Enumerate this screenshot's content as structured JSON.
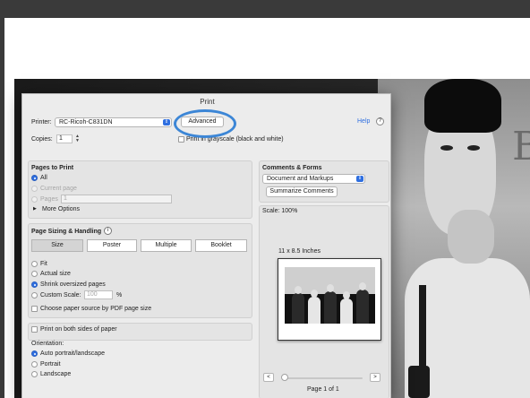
{
  "dialog": {
    "title": "Print",
    "printer_label": "Printer:",
    "printer_value": "RC-Ricoh-C831DN",
    "advanced_label": "Advanced",
    "help_label": "Help",
    "help_icon": "?",
    "copies_label": "Copies:",
    "copies_value": "1",
    "grayscale_label": "Print in grayscale (black and white)"
  },
  "pages_to_print": {
    "heading": "Pages to Print",
    "all_label": "All",
    "current_label": "Current page",
    "pages_label": "Pages",
    "pages_value": "1",
    "more_options_label": "More Options"
  },
  "sizing": {
    "heading": "Page Sizing & Handling",
    "info_icon": "i",
    "tabs": [
      "Size",
      "Poster",
      "Multiple",
      "Booklet"
    ],
    "selected_tab": "Size",
    "fit_label": "Fit",
    "actual_label": "Actual size",
    "shrink_label": "Shrink oversized pages",
    "custom_label": "Custom Scale:",
    "custom_value": "100",
    "percent_label": "%",
    "paper_source_label": "Choose paper source by PDF page size"
  },
  "duplex": {
    "both_sides_label": "Print on both sides of paper"
  },
  "orientation": {
    "heading": "Orientation:",
    "auto_label": "Auto portrait/landscape",
    "portrait_label": "Portrait",
    "landscape_label": "Landscape"
  },
  "comments": {
    "heading": "Comments & Forms",
    "select_value": "Document and Markups",
    "summarize_label": "Summarize Comments"
  },
  "preview": {
    "scale_label": "Scale: 100%",
    "paper_size_label": "11 x 8.5 Inches",
    "prev_label": "<",
    "next_label": ">",
    "page_indicator": "Page 1 of 1",
    "slider_fraction": 0.0
  },
  "colors": {
    "accent": "#2f6fe0",
    "annotation_circle": "#3c86d6",
    "dialog_bg": "#ececec"
  }
}
